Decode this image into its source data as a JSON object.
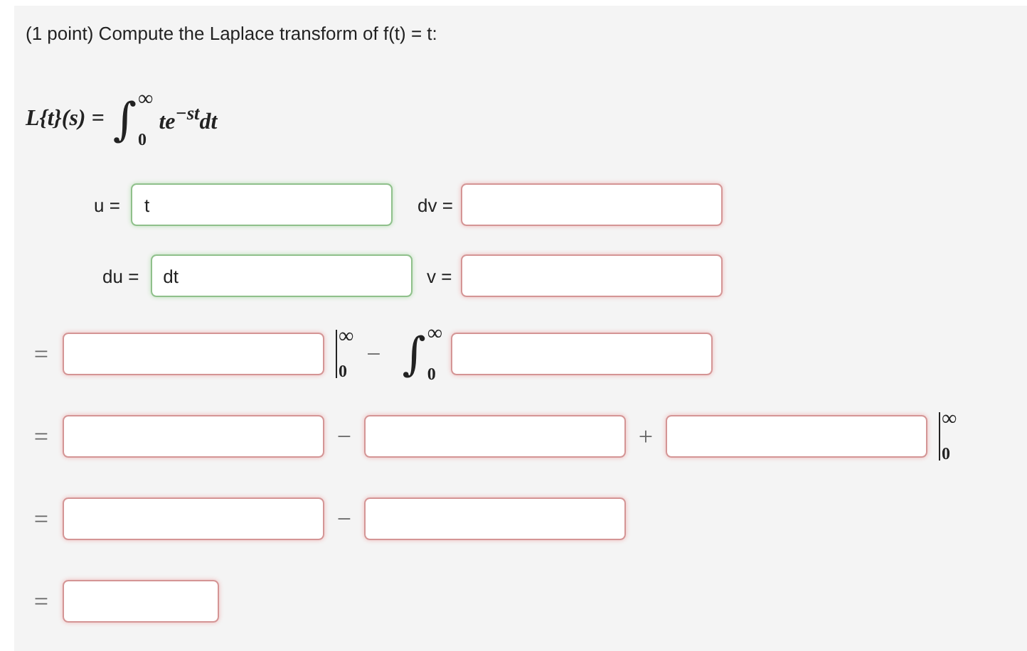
{
  "problem": "(1 point) Compute the Laplace transform of f(t) = t:",
  "definition": {
    "lhs": "L{t}(s) =",
    "integral": {
      "symbol": "∫",
      "lower": "0",
      "upper": "∞"
    },
    "integrand": "te$^{−st}$dt"
  },
  "substitution": [
    {
      "left": {
        "label": "u =",
        "value": "t",
        "correct": true
      },
      "right": {
        "label": "dv =",
        "correct": false
      }
    },
    {
      "left": {
        "label": "du =",
        "value": "dt",
        "correct": true
      },
      "right": {
        "label": "v =",
        "correct": false
      }
    }
  ],
  "steps": [
    {
      "items": [
        {
          "kind": "op",
          "text": "="
        },
        {
          "kind": "field",
          "correct": false
        },
        {
          "kind": "bar",
          "upper": "∞",
          "lower": "0"
        },
        {
          "kind": "op",
          "text": "−"
        },
        {
          "kind": "integral",
          "symbol": "∫",
          "upper": "∞",
          "lower": "0"
        },
        {
          "kind": "field",
          "correct": false
        }
      ]
    },
    {
      "items": [
        {
          "kind": "op",
          "text": "="
        },
        {
          "kind": "field",
          "correct": false
        },
        {
          "kind": "op",
          "text": "−"
        },
        {
          "kind": "field",
          "correct": false
        },
        {
          "kind": "op",
          "text": "+"
        },
        {
          "kind": "field",
          "correct": false
        },
        {
          "kind": "bar",
          "upper": "∞",
          "lower": "0"
        }
      ]
    },
    {
      "items": [
        {
          "kind": "op",
          "text": "="
        },
        {
          "kind": "field",
          "correct": false
        },
        {
          "kind": "op",
          "text": "−"
        },
        {
          "kind": "field",
          "correct": false
        }
      ]
    },
    {
      "items": [
        {
          "kind": "op",
          "text": "="
        },
        {
          "kind": "short_field",
          "correct": false
        }
      ]
    }
  ]
}
